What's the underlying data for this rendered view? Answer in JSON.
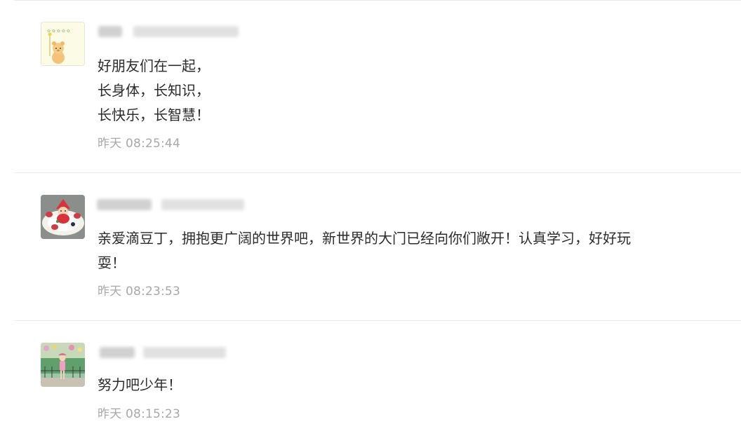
{
  "comments": [
    {
      "avatar_icon": "bear-cartoon-avatar-icon",
      "name": "",
      "lines": [
        "好朋友们在一起，",
        "长身体，长知识，",
        "长快乐，长智慧！"
      ],
      "time": "昨天 08:25:44"
    },
    {
      "avatar_icon": "santa-cake-avatar-icon",
      "name": "",
      "lines": [
        "亲爱滴豆丁，拥抱更广阔的世界吧，新世界的大门已经向你们敞开！认真学习，好好玩",
        "耍！"
      ],
      "time": "昨天 08:23:53"
    },
    {
      "avatar_icon": "child-garden-avatar-icon",
      "name": "",
      "lines": [
        "努力吧少年！"
      ],
      "time": "昨天 08:15:23"
    }
  ],
  "colors": {
    "text": "#2b2b2b",
    "time": "#a8a8a8",
    "divider": "#ebebeb"
  }
}
